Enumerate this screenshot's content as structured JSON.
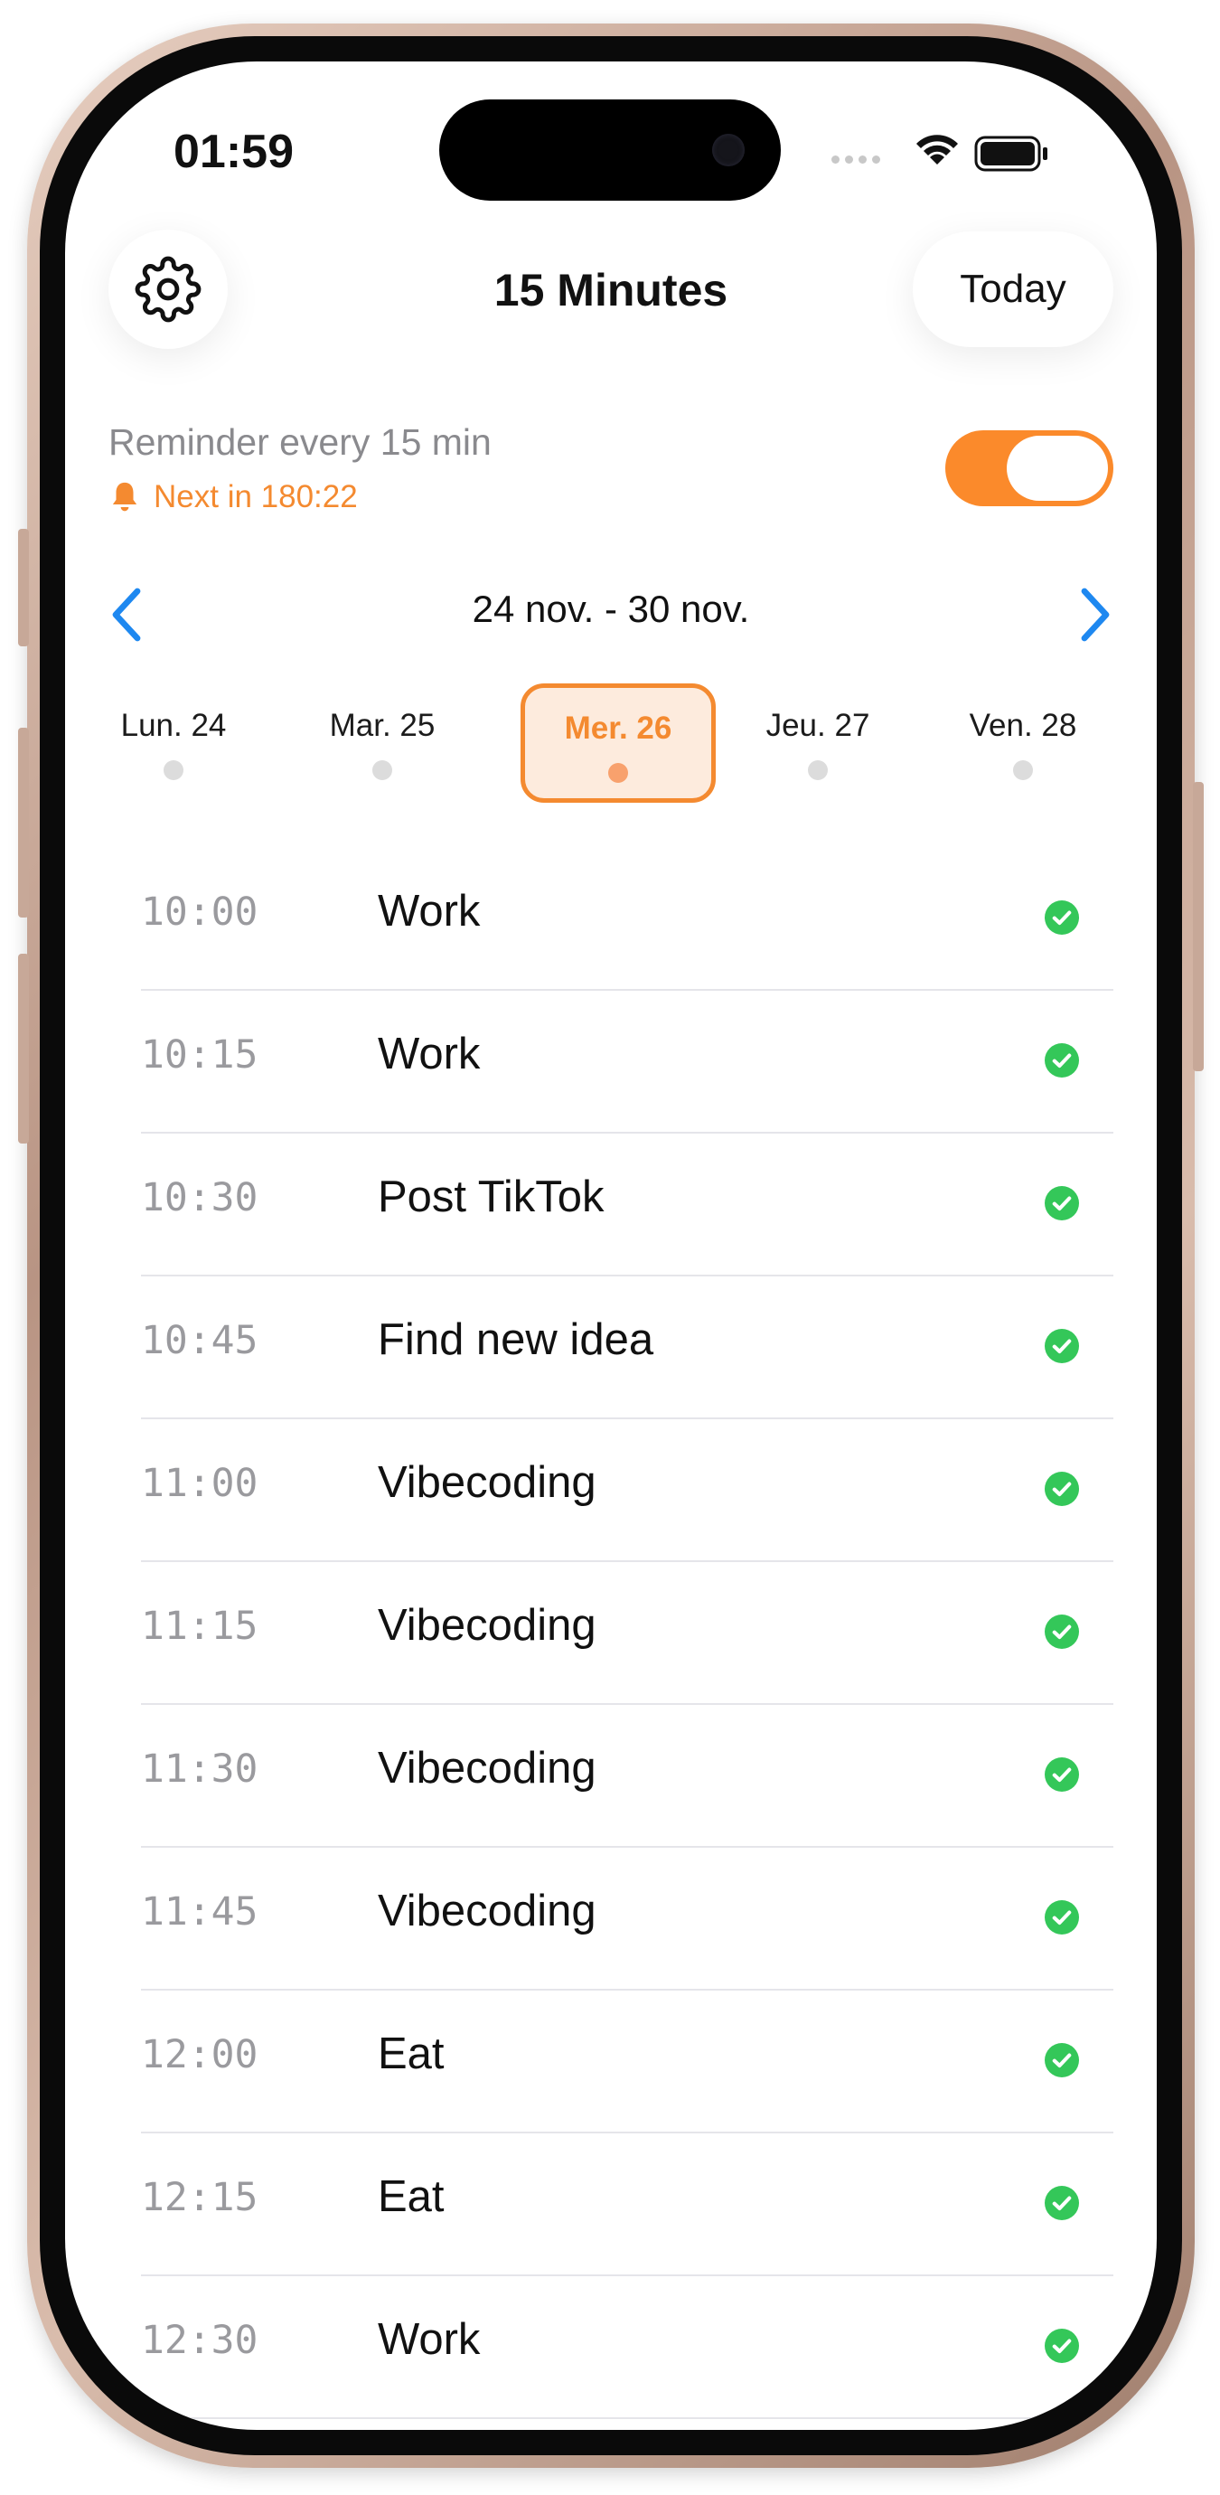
{
  "status_bar": {
    "time": "01:59"
  },
  "header": {
    "title": "15 Minutes",
    "today_label": "Today"
  },
  "reminder": {
    "label": "Reminder every 15 min",
    "next_label": "Next in 180:22",
    "enabled": true
  },
  "week": {
    "range": "24 nov. - 30 nov.",
    "days": [
      {
        "label": "Lun. 24",
        "selected": false
      },
      {
        "label": "Mar. 25",
        "selected": false
      },
      {
        "label": "Mer. 26",
        "selected": true
      },
      {
        "label": "Jeu. 27",
        "selected": false
      },
      {
        "label": "Ven. 28",
        "selected": false
      }
    ]
  },
  "entries": [
    {
      "time": "10:00",
      "activity": "Work",
      "done": true
    },
    {
      "time": "10:15",
      "activity": "Work",
      "done": true
    },
    {
      "time": "10:30",
      "activity": "Post TikTok",
      "done": true
    },
    {
      "time": "10:45",
      "activity": "Find new idea",
      "done": true
    },
    {
      "time": "11:00",
      "activity": "Vibecoding",
      "done": true
    },
    {
      "time": "11:15",
      "activity": "Vibecoding",
      "done": true
    },
    {
      "time": "11:30",
      "activity": "Vibecoding",
      "done": true
    },
    {
      "time": "11:45",
      "activity": "Vibecoding",
      "done": true
    },
    {
      "time": "12:00",
      "activity": "Eat",
      "done": true
    },
    {
      "time": "12:15",
      "activity": "Eat",
      "done": true
    },
    {
      "time": "12:30",
      "activity": "Work",
      "done": true
    }
  ],
  "colors": {
    "accent": "#F48A30",
    "toggle_on": "#FB8A2B",
    "check": "#34C759",
    "nav_chevron": "#1E88F0"
  }
}
